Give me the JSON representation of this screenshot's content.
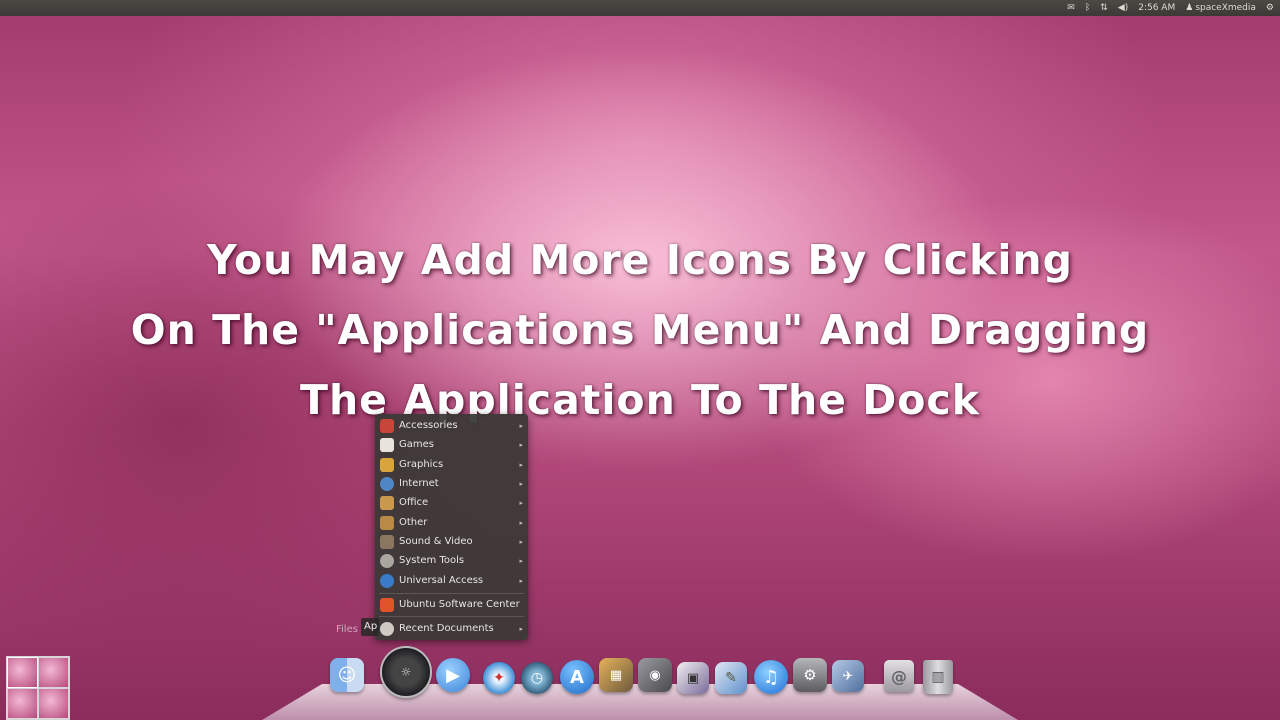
{
  "top_panel": {
    "icons": [
      "mail-icon",
      "bluetooth-icon",
      "network-icon",
      "volume-icon"
    ],
    "time": "2:56 AM",
    "user": "spaceXmedia"
  },
  "caption": {
    "line1": "You May Add More Icons By Clicking",
    "line2": "On The \"Applications Menu\" And Dragging",
    "line3": "The Application To The Dock"
  },
  "menu": {
    "items": [
      {
        "label": "Accessories",
        "icon": "accessories-icon",
        "color": "#c8453a"
      },
      {
        "label": "Games",
        "icon": "games-icon",
        "color": "#e8e4dc"
      },
      {
        "label": "Graphics",
        "icon": "graphics-icon",
        "color": "#d9a43a"
      },
      {
        "label": "Internet",
        "icon": "internet-icon",
        "color": "#4f86c6"
      },
      {
        "label": "Office",
        "icon": "office-icon",
        "color": "#c99a4e"
      },
      {
        "label": "Other",
        "icon": "other-icon",
        "color": "#b78a45"
      },
      {
        "label": "Sound & Video",
        "icon": "sound-video-icon",
        "color": "#8b7760"
      },
      {
        "label": "System Tools",
        "icon": "system-tools-icon",
        "color": "#aaa6a0"
      },
      {
        "label": "Universal Access",
        "icon": "universal-access-icon",
        "color": "#3a7bc8"
      },
      {
        "label": "Ubuntu Software Center",
        "icon": "software-center-icon",
        "color": "#e0542a"
      },
      {
        "label": "Recent Documents",
        "icon": "recent-documents-icon",
        "color": "#cfcac3"
      }
    ]
  },
  "dock": {
    "tooltip_files": "Files",
    "tooltip_apps": "Ap",
    "icons": [
      {
        "name": "finder-icon",
        "color": "#5c8fd8"
      },
      {
        "name": "applications-menu-icon",
        "color": "#2f2f33"
      },
      {
        "name": "ichat-icon",
        "color": "#5aa0e8"
      },
      {
        "name": "safari-icon",
        "color": "#3d8fd6"
      },
      {
        "name": "time-machine-icon",
        "color": "#3b6e8e"
      },
      {
        "name": "app-store-icon",
        "color": "#2e7fd9"
      },
      {
        "name": "iphoto-icon",
        "color": "#8a7a5c"
      },
      {
        "name": "photo-booth-icon",
        "color": "#6f6f74"
      },
      {
        "name": "image-viewer-icon",
        "color": "#7a6a9a"
      },
      {
        "name": "chart-icon",
        "color": "#5f8fc9"
      },
      {
        "name": "pencil-icon",
        "color": "#7c6fb4"
      },
      {
        "name": "itunes-icon",
        "color": "#3a8ce0"
      },
      {
        "name": "system-preferences-icon",
        "color": "#8e8e92"
      },
      {
        "name": "preview-icon",
        "color": "#6a8ec0"
      },
      {
        "name": "mail-stamp-icon",
        "color": "#b5b3b8"
      },
      {
        "name": "trash-icon",
        "color": "#c8c6cc"
      }
    ]
  }
}
